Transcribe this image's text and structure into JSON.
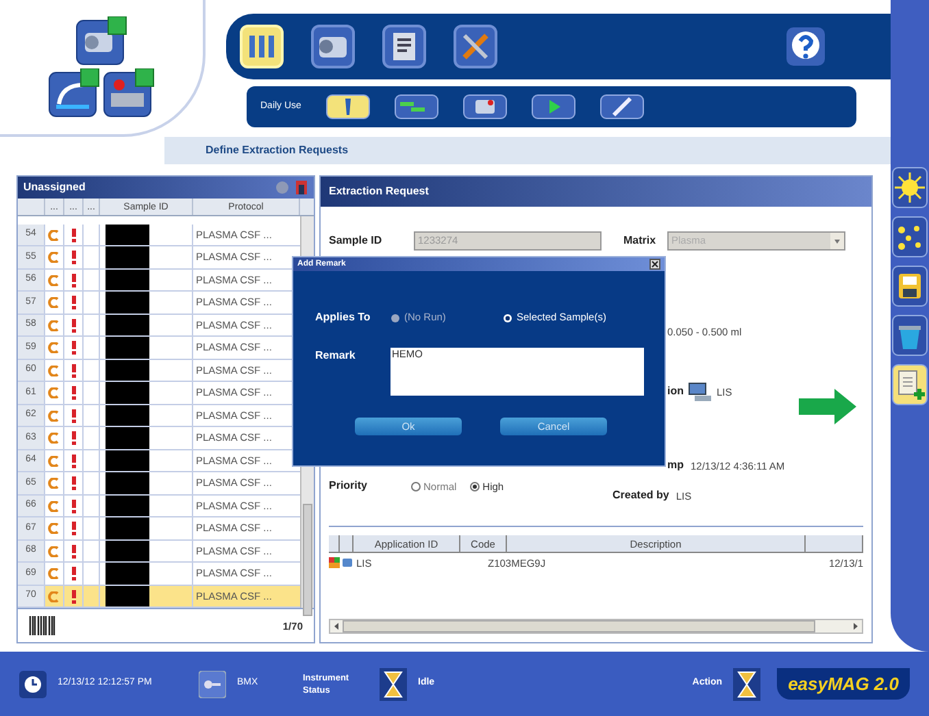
{
  "main_toolbar": {
    "tools": [
      {
        "selected": true
      },
      {
        "selected": false
      },
      {
        "selected": false
      },
      {
        "selected": false
      }
    ]
  },
  "sub_toolbar": {
    "label": "Daily Use",
    "tools": [
      {
        "selected": true
      },
      {
        "selected": false
      },
      {
        "selected": false
      },
      {
        "selected": false
      },
      {
        "selected": false
      }
    ]
  },
  "breadcrumb": "Define Extraction Requests",
  "unassigned": {
    "title": "Unassigned",
    "columns": [
      "...",
      "...",
      "...",
      "Sample ID",
      "Protocol"
    ],
    "rows": [
      {
        "number": "54",
        "redacted": true,
        "protocol": "PLASMA CSF ...",
        "selected": false
      },
      {
        "number": "55",
        "redacted": true,
        "protocol": "PLASMA CSF ...",
        "selected": false
      },
      {
        "number": "56",
        "redacted": true,
        "protocol": "PLASMA CSF ...",
        "selected": false
      },
      {
        "number": "57",
        "redacted": true,
        "protocol": "PLASMA CSF ...",
        "selected": false
      },
      {
        "number": "58",
        "redacted": true,
        "protocol": "PLASMA CSF ...",
        "selected": false
      },
      {
        "number": "59",
        "redacted": true,
        "protocol": "PLASMA CSF ...",
        "selected": false
      },
      {
        "number": "60",
        "redacted": true,
        "protocol": "PLASMA CSF ...",
        "selected": false
      },
      {
        "number": "61",
        "redacted": true,
        "protocol": "PLASMA CSF ...",
        "selected": false
      },
      {
        "number": "62",
        "redacted": true,
        "protocol": "PLASMA CSF ...",
        "selected": false
      },
      {
        "number": "63",
        "redacted": true,
        "protocol": "PLASMA CSF ...",
        "selected": false
      },
      {
        "number": "64",
        "redacted": true,
        "protocol": "PLASMA CSF ...",
        "selected": false
      },
      {
        "number": "65",
        "redacted": true,
        "protocol": "PLASMA CSF ...",
        "selected": false
      },
      {
        "number": "66",
        "redacted": true,
        "protocol": "PLASMA CSF ...",
        "selected": false
      },
      {
        "number": "67",
        "redacted": true,
        "protocol": "PLASMA CSF ...",
        "selected": false
      },
      {
        "number": "68",
        "redacted": true,
        "protocol": "PLASMA CSF ...",
        "selected": false
      },
      {
        "number": "69",
        "redacted": true,
        "protocol": "PLASMA CSF ...",
        "selected": false
      },
      {
        "number": "70",
        "redacted": true,
        "protocol": "PLASMA CSF ...",
        "selected": true
      }
    ],
    "count": "1/70"
  },
  "extraction_request": {
    "title": "Extraction Request",
    "sample_id": {
      "label": "Sample ID",
      "value": "1233274",
      "disabled": true
    },
    "matrix": {
      "label": "Matrix",
      "value": "Plasma",
      "disabled": true
    },
    "volume": "0.050 - 0.500 ml",
    "location": {
      "label": "ion",
      "value": "LIS"
    },
    "timestamp": {
      "label": "mp",
      "value": "12/13/12 4:36:11 AM"
    },
    "priority": {
      "label": "Priority",
      "options": [
        {
          "label": "Normal",
          "selected": false
        },
        {
          "label": "High",
          "selected": true
        }
      ]
    },
    "created_by": {
      "label": "Created by",
      "value": "LIS"
    },
    "applications": {
      "columns": [
        "",
        "",
        "Application ID",
        "Code",
        "Description",
        ""
      ],
      "rows": [
        {
          "application_id": "LIS",
          "code": "Z103MEG9J",
          "description": "",
          "date": "12/13/1"
        }
      ]
    }
  },
  "dialog": {
    "title": "Add Remark",
    "applies_to": {
      "label": "Applies To",
      "options": [
        {
          "label": "(No Run)",
          "selected": false
        },
        {
          "label": "Selected Sample(s)",
          "selected": true
        }
      ]
    },
    "remark": {
      "label": "Remark",
      "value": "HEMO"
    },
    "buttons": [
      "Ok",
      "Cancel"
    ]
  },
  "side_actions": [
    {
      "selected": false
    },
    {
      "selected": false
    },
    {
      "selected": false
    },
    {
      "selected": false
    },
    {
      "selected": true
    }
  ],
  "status_bar": {
    "datetime": "12/13/12 12:12:57 PM",
    "user": "BMX",
    "instrument_status_label": "Instrument Status",
    "instrument_status": "Idle",
    "action_label": "Action",
    "logo": "easyMAG 2.0"
  }
}
